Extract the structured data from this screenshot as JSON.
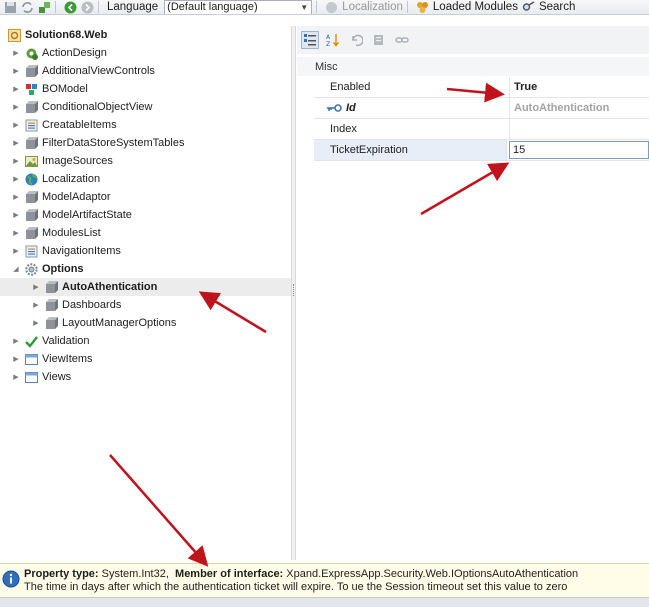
{
  "toolbar": {
    "language_label": "Language",
    "language_value": "(Default language)",
    "localization_label": "Localization",
    "loaded_modules_label": "Loaded Modules",
    "search_label": "Search"
  },
  "tree": {
    "root_label": "Solution68.Web",
    "items": [
      {
        "label": "ActionDesign",
        "icon": "gear-green-icon"
      },
      {
        "label": "AdditionalViewControls",
        "icon": "cube-icon"
      },
      {
        "label": "BOModel",
        "icon": "model-icon"
      },
      {
        "label": "ConditionalObjectView",
        "icon": "cube-icon"
      },
      {
        "label": "CreatableItems",
        "icon": "list-icon"
      },
      {
        "label": "FilterDataStoreSystemTables",
        "icon": "cube-icon"
      },
      {
        "label": "ImageSources",
        "icon": "image-icon"
      },
      {
        "label": "Localization",
        "icon": "globe-icon"
      },
      {
        "label": "ModelAdaptor",
        "icon": "cube-icon"
      },
      {
        "label": "ModelArtifactState",
        "icon": "cube-icon"
      },
      {
        "label": "ModulesList",
        "icon": "cube-icon"
      },
      {
        "label": "NavigationItems",
        "icon": "list-icon"
      },
      {
        "label": "Options",
        "icon": "gear-icon"
      },
      {
        "label": "AutoAthentication",
        "icon": "cube-icon"
      },
      {
        "label": "Dashboards",
        "icon": "cube-icon"
      },
      {
        "label": "LayoutManagerOptions",
        "icon": "cube-icon"
      },
      {
        "label": "Validation",
        "icon": "check-icon"
      },
      {
        "label": "ViewItems",
        "icon": "window-icon"
      },
      {
        "label": "Views",
        "icon": "window-icon"
      }
    ]
  },
  "grid": {
    "category": "Misc",
    "properties": [
      {
        "name": "Enabled",
        "value": "True"
      },
      {
        "name": "Id",
        "value": "AutoAthentication"
      },
      {
        "name": "Index",
        "value": ""
      },
      {
        "name": "TicketExpiration",
        "value": "15"
      }
    ]
  },
  "info": {
    "property_type_label": "Property type:",
    "property_type_value": "System.Int32,",
    "member_label": "Member of interface:",
    "member_value": "Xpand.ExpressApp.Security.Web.IOptionsAutoAthentication",
    "description": "The time in days after which the authentication ticket will expire. To ue the Session timeout set this value to zero"
  },
  "colors": {
    "arrow": "#c0141c",
    "selection": "#ececec",
    "info_bg": "#fffde7"
  }
}
